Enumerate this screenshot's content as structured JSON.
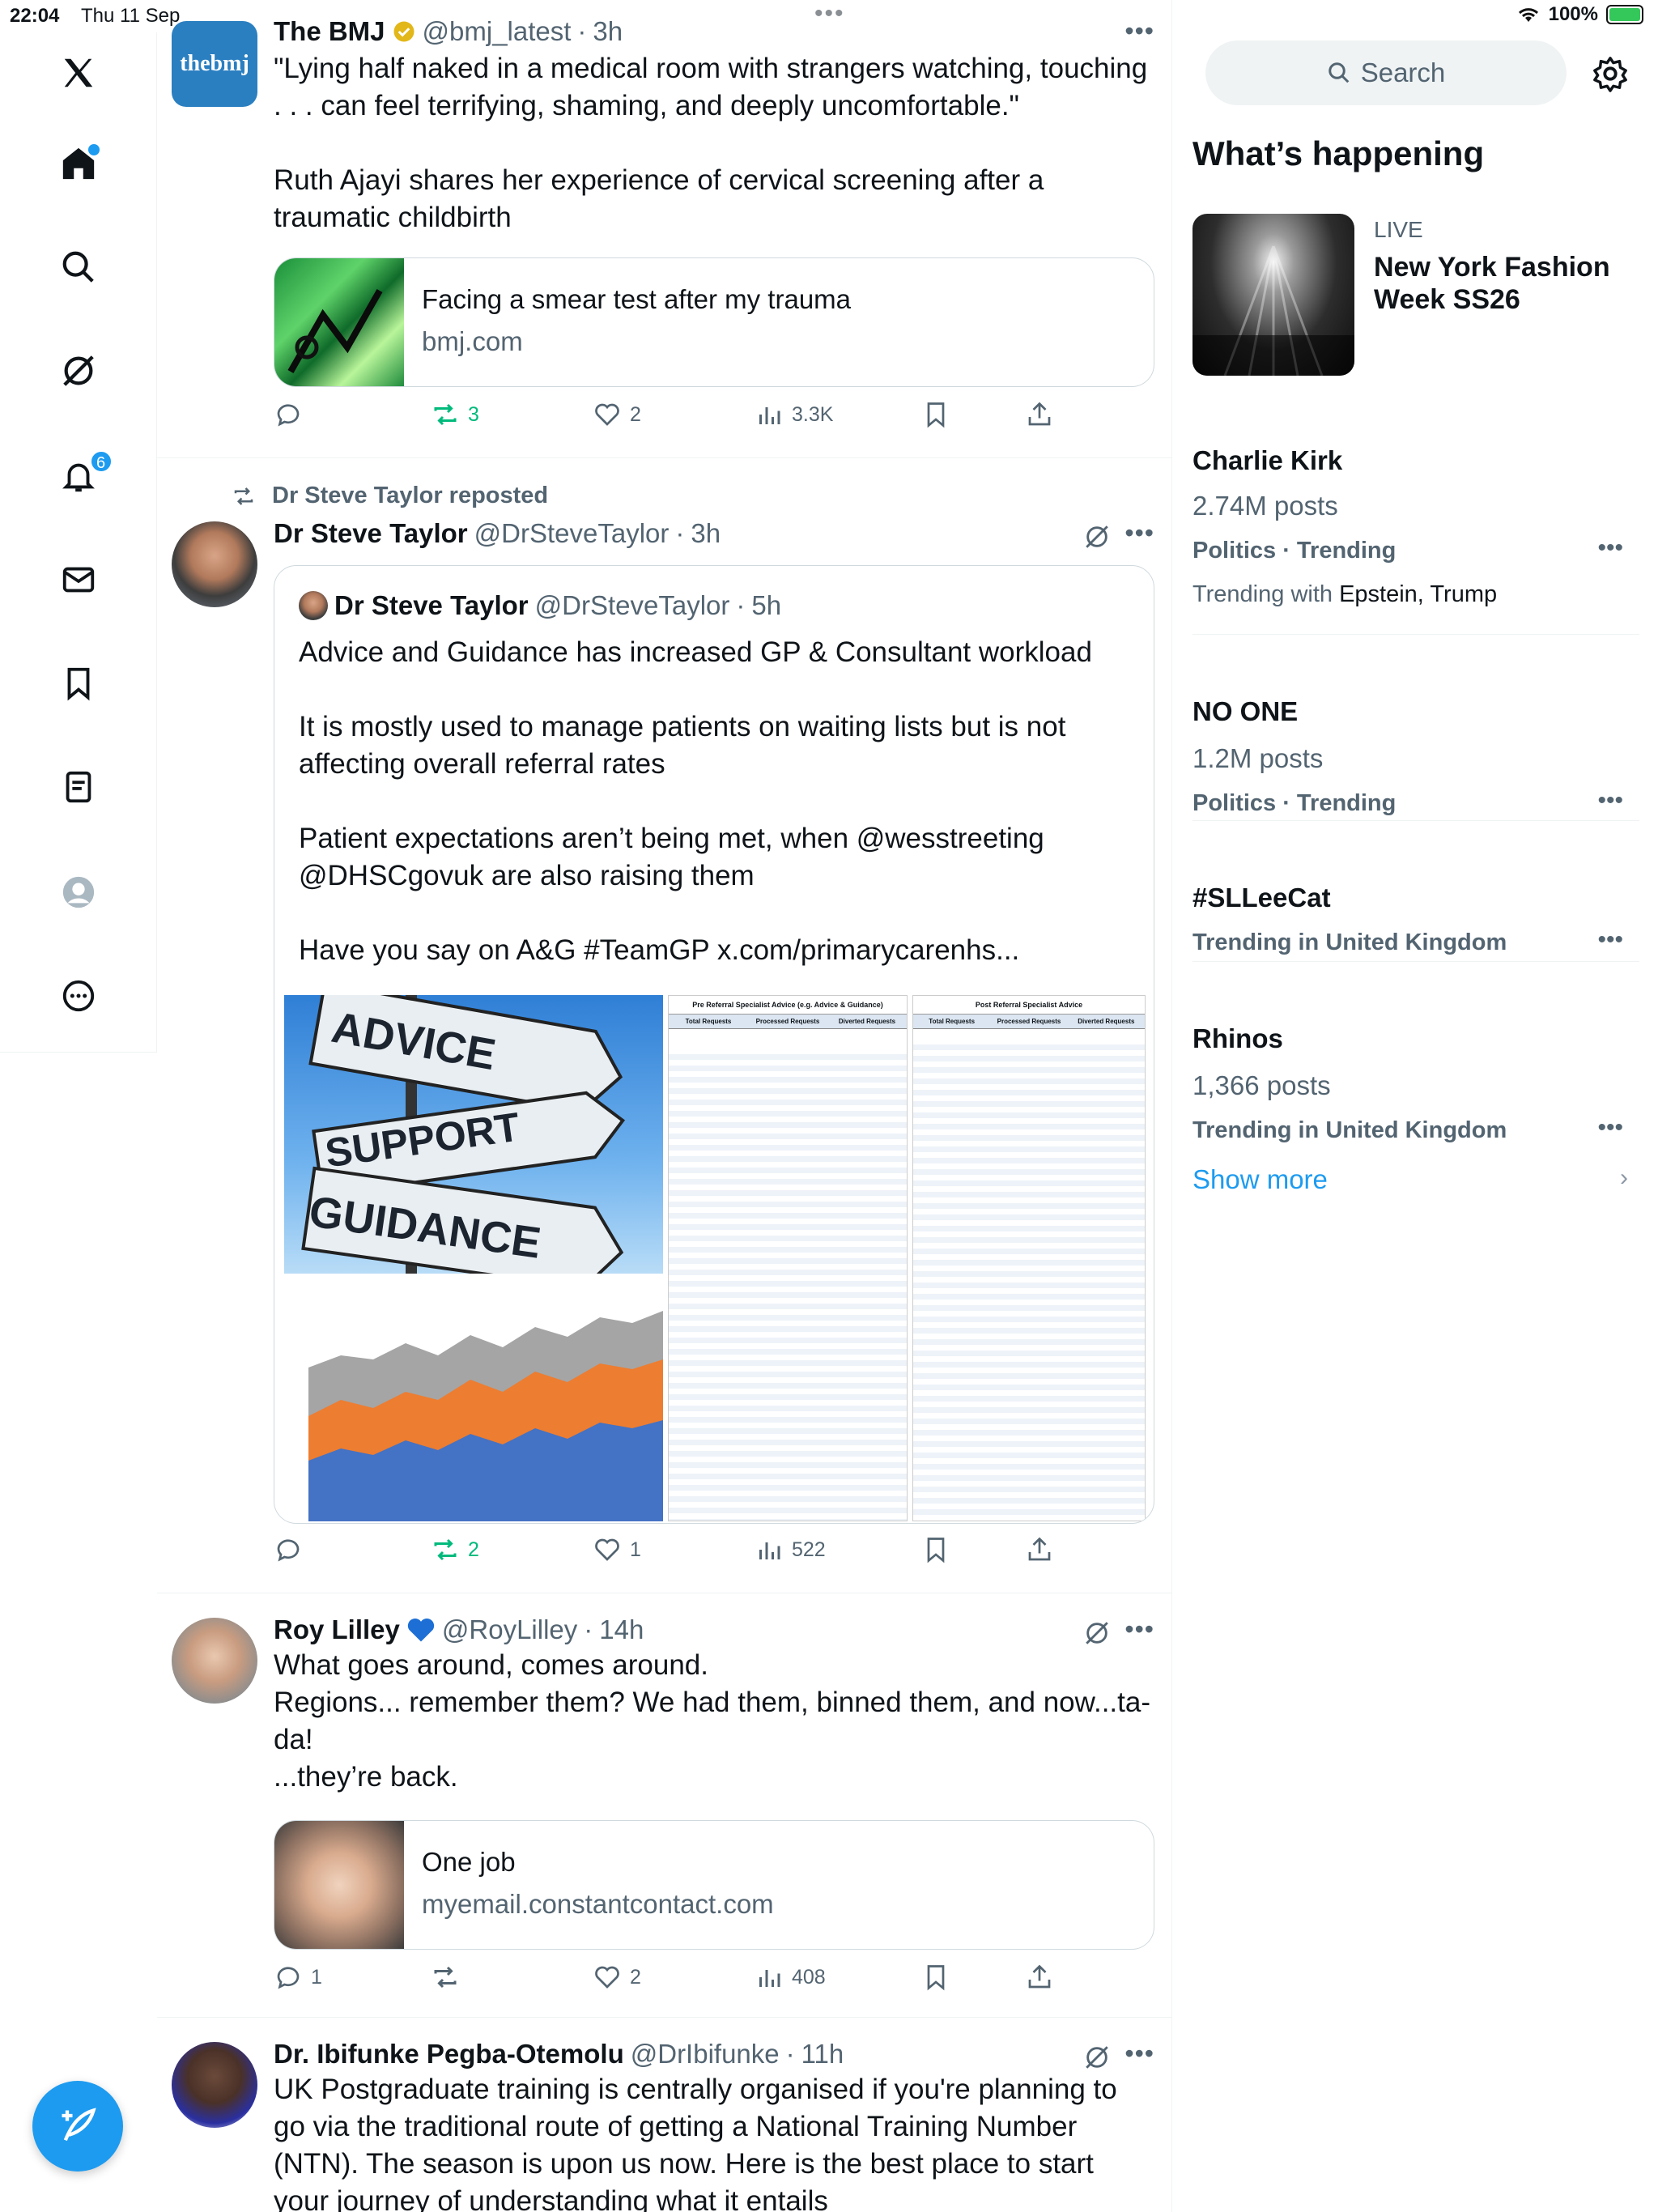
{
  "status": {
    "time": "22:04",
    "date": "Thu 11 Sep",
    "battery": "100%"
  },
  "nav": {
    "notifications_badge": "6"
  },
  "tweets": [
    {
      "name": "The BMJ",
      "handle": "@bmj_latest",
      "time": "3h",
      "avatar_text": "thebmj",
      "text": "\"Lying half naked in a medical room with strangers watching, touching . . . can feel terrifying, shaming, and deeply uncomfortable.\"\n\nRuth Ajayi shares her experience of cervical screening after a traumatic childbirth",
      "card": {
        "title": "Facing a smear test after my trauma",
        "domain": "bmj.com"
      },
      "reposts": "3",
      "likes": "2",
      "views": "3.3K"
    },
    {
      "repost_label": "Dr Steve Taylor reposted",
      "name": "Dr Steve Taylor",
      "handle": "@DrSteveTaylor",
      "time": "3h",
      "quote": {
        "name": "Dr Steve Taylor",
        "handle": "@DrSteveTaylor",
        "time": "5h",
        "text": "Advice and Guidance has increased GP & Consultant workload\n\nIt is mostly used to manage patients on waiting lists but is not affecting overall referral rates\n\nPatient expectations aren’t being met, when @wesstreeting @DHSCgovuk are also raising them\n\nHave you say on A&G #TeamGP x.com/primarycarenhs...",
        "sign_words": [
          "ADVICE",
          "SUPPORT",
          "GUIDANCE"
        ],
        "table1_title": "Pre Referral Specialist Advice (e.g. Advice & Guidance)",
        "table2_title": "Post Referral Specialist Advice",
        "table_headers": [
          "Total Requests",
          "Processed Requests",
          "Diverted Requests"
        ]
      },
      "reposts": "2",
      "likes": "1",
      "views": "522"
    },
    {
      "name": "Roy Lilley",
      "handle": "@RoyLilley",
      "time": "14h",
      "text": "What goes around, comes around.\nRegions... remember them? We had them, binned them, and now...ta-da!\n...they’re back.",
      "card": {
        "title": "One job",
        "domain": "myemail.constantcontact.com"
      },
      "replies": "1",
      "likes": "2",
      "views": "408"
    },
    {
      "name": "Dr. Ibifunke Pegba-Otemolu",
      "handle": "@DrIbifunke",
      "time": "11h",
      "text": "UK Postgraduate training is centrally organised if you're planning to go via the traditional route of getting a National Training Number (NTN). The season is upon us now. Here is the best place to start your journey of understanding what it entails"
    }
  ],
  "sidebar": {
    "search_placeholder": "Search",
    "title": "What’s happening",
    "featured": {
      "label": "LIVE",
      "title": "New York Fashion Week SS26"
    },
    "trends": [
      {
        "name": "Charlie Kirk",
        "posts": "2.74M posts",
        "category": "Politics · Trending",
        "with_label": "Trending with",
        "with_terms": "Epstein, Trump"
      },
      {
        "name": "NO ONE",
        "posts": "1.2M posts",
        "category": "Politics · Trending"
      },
      {
        "name": "#SLLeeCat",
        "category": "Trending in United Kingdom"
      },
      {
        "name": "Rhinos",
        "posts": "1,366 posts",
        "category": "Trending in United Kingdom"
      }
    ],
    "show_more": "Show more"
  }
}
